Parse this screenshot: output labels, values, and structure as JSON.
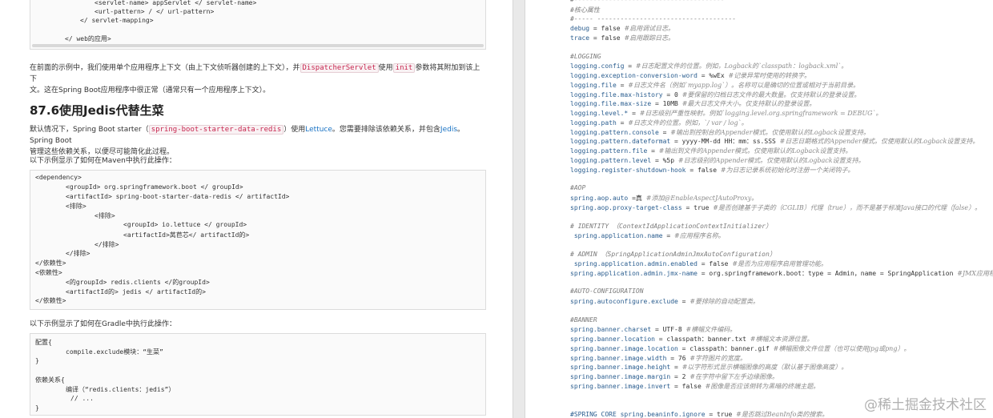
{
  "left": {
    "top_code": [
      {
        "indent": 80,
        "text": "<servlet-name> appServlet </ servlet-name>"
      },
      {
        "indent": 80,
        "text": "<url-pattern> / </ url-pattern>"
      },
      {
        "indent": 62,
        "text": "</ servlet-mapping>"
      },
      {
        "indent": 43,
        "text": ""
      },
      {
        "indent": 43,
        "text": "</ web的应用>"
      }
    ],
    "para1_a": "在前面的示例中，我们使用单个应用程序上下文（由上下文侦听器创建的上下文），并",
    "para1_code1": "DispatcherServlet",
    "para1_b": "使用",
    "para1_code2": "init",
    "para1_c": "参数将其附加到该上下",
    "para1_d": "文。这在Spring Boot应用程序中很正常（通常只有一个应用程序上下文）。",
    "heading": "87.6使用Jedis代替生菜",
    "para2_a": "默认情况下，Spring Boot starter（",
    "para2_code": "spring-boot-starter-data-redis",
    "para2_b": "）使用",
    "para2_link1": "Lettuce",
    "para2_c": "。您需要排除该依赖关系，并包含",
    "para2_link2": "Jedis",
    "para2_d": "。Spring Boot",
    "para2_e": "管理这些依赖关系，以便尽可能简化此过程。",
    "maven_caption": "以下示例显示了如何在Maven中执行此操作：",
    "maven_code": [
      {
        "indent": 0,
        "text": "<dependency>"
      },
      {
        "indent": 38,
        "text": "<groupId> org.springframework.boot </ groupId>"
      },
      {
        "indent": 38,
        "text": "<artifactId> spring-boot-starter-data-redis </ artifactId>"
      },
      {
        "indent": 38,
        "text": "<排除>"
      },
      {
        "indent": 74,
        "text": "<排除>"
      },
      {
        "indent": 110,
        "text": "<groupId> io.lettuce </ groupId>"
      },
      {
        "indent": 110,
        "text": "<artifactId>莴苣芯</ artifactId的>"
      },
      {
        "indent": 74,
        "text": "</排除>"
      },
      {
        "indent": 38,
        "text": "</排除>"
      },
      {
        "indent": 0,
        "text": "</依赖性>"
      },
      {
        "indent": 0,
        "text": "<依赖性>"
      },
      {
        "indent": 38,
        "text": "<的groupId> redis.clients </的groupId>"
      },
      {
        "indent": 38,
        "text": "<artifactId的> jedis </ artifactId的>"
      },
      {
        "indent": 0,
        "text": "</依赖性>"
      }
    ],
    "gradle_caption": "以下示例显示了如何在Gradle中执行此操作：",
    "gradle_code": [
      {
        "indent": 0,
        "text": "配置{"
      },
      {
        "indent": 38,
        "text": "compile.exclude模块：“生菜”"
      },
      {
        "indent": 0,
        "text": "}"
      },
      {
        "indent": 0,
        "text": ""
      },
      {
        "indent": 0,
        "text": "依赖关系{"
      },
      {
        "indent": 38,
        "text": "编译（“redis.clients：jedis”）"
      },
      {
        "indent": 44,
        "text": "// ..."
      },
      {
        "indent": 0,
        "text": "}"
      }
    ]
  },
  "right": {
    "lines": [
      {
        "k": "",
        "v": "",
        "c": "#---------------------------------------"
      },
      {
        "k": "",
        "v": "",
        "c": "#核心属性"
      },
      {
        "k": "",
        "v": "",
        "c": "#----- ------------------------------------"
      },
      {
        "k": "debug",
        "v": " = false ",
        "c": "#启用调试日志。"
      },
      {
        "k": "trace",
        "v": " = false ",
        "c": "#启用跟踪日志。"
      },
      {
        "k": "",
        "v": "",
        "c": ""
      },
      {
        "k": "",
        "v": "",
        "c": "#LOGGING"
      },
      {
        "k": "logging.config",
        "v": " = ",
        "c": "#日志配置文件的位置。例如，Logback的`classpath：logback.xml`。"
      },
      {
        "k": "logging.exception-conversion-word",
        "v": " = %wEx ",
        "c": "#记录异常时使用的转换字。"
      },
      {
        "k": "logging.file",
        "v": " = ",
        "c": "#日志文件名（例如`myapp.log`）。名称可以是确切的位置或相对于当前目录。"
      },
      {
        "k": "logging.file.max-history",
        "v": " = 0 ",
        "c": "#要保留的归档日志文件的最大数量。仅支持默认的登录设置。"
      },
      {
        "k": "logging.file.max-size",
        "v": " = 10MB ",
        "c": "#最大日志文件大小。仅支持默认的登录设置。"
      },
      {
        "k": "logging.level.*",
        "v": " = ",
        "c": "#日志级别严重性映射。例如`logging.level.org.springframework = DEBUG`。"
      },
      {
        "k": "logging.path",
        "v": " = ",
        "c": "#日志文件的位置。例如，`/ var / log`。"
      },
      {
        "k": "logging.pattern.console",
        "v": " = ",
        "c": "#输出到控制台的Appender模式。仅使用默认的Logback设置支持。"
      },
      {
        "k": "logging.pattern.dateformat",
        "v": " = yyyy-MM-dd HH：mm：ss.SSS ",
        "c": "#日志日期格式的Appender模式。仅使用默认的Logback设置支持。"
      },
      {
        "k": "logging.pattern.file",
        "v": " = ",
        "c": "#输出到文件的Appender模式。仅使用默认的Logback设置支持。"
      },
      {
        "k": "logging.pattern.level",
        "v": " = %5p ",
        "c": "#日志级别的Appender模式。仅使用默认的Logback设置支持。"
      },
      {
        "k": "logging.register-shutdown-hook",
        "v": " = false ",
        "c": "#为日志记录系统初始化时注册一个关闭钩子。"
      },
      {
        "k": "",
        "v": "",
        "c": ""
      },
      {
        "k": "",
        "v": "",
        "c": "#AOP"
      },
      {
        "k": "spring.aop.auto",
        "v": " =真 ",
        "c": "#添加@EnableAspectJAutoProxy。"
      },
      {
        "k": "spring.aop.proxy-target-class",
        "v": " = true ",
        "c": "#是否创建基于子类的（CGLIB）代理（true），而不是基于标准Java接口的代理（false）。"
      },
      {
        "k": "",
        "v": "",
        "c": ""
      },
      {
        "k": "",
        "v": "",
        "c": "# IDENTITY （ContextIdApplicationContextInitializer）"
      },
      {
        "k": " spring.application.name",
        "v": " = ",
        "c": "#应用程序名称。"
      },
      {
        "k": "",
        "v": "",
        "c": ""
      },
      {
        "k": "",
        "v": "",
        "c": "# ADMIN （SpringApplicationAdminJmxAutoConfiguration）"
      },
      {
        "k": " spring.application.admin.enabled",
        "v": " = false ",
        "c": "#是否为应用程序启用管理功能。"
      },
      {
        "k": "spring.application.admin.jmx-name",
        "v": " = org.springframework.boot：type = Admin，name = SpringApplication ",
        "c": "#JMX应用程序"
      },
      {
        "k": "",
        "v": "",
        "c": ""
      },
      {
        "k": "",
        "v": "",
        "c": "#AUTO-CONFIGURATION"
      },
      {
        "k": "spring.autoconfigure.exclude",
        "v": " = ",
        "c": "#要排除的自动配置类。"
      },
      {
        "k": "",
        "v": "",
        "c": ""
      },
      {
        "k": "",
        "v": "",
        "c": "#BANNER"
      },
      {
        "k": "spring.banner.charset",
        "v": " = UTF-8 ",
        "c": "#横幅文件编码。"
      },
      {
        "k": "spring.banner.location",
        "v": " = classpath：banner.txt ",
        "c": "#横幅文本资源位置。"
      },
      {
        "k": "spring.banner.image.location",
        "v": " = classpath：banner.gif ",
        "c": "#横幅图像文件位置（也可以使用jpg或png）。"
      },
      {
        "k": "spring.banner.image.width",
        "v": " = 76 ",
        "c": "#字符图片的宽度。"
      },
      {
        "k": "spring.banner.image.height",
        "v": " = ",
        "c": "#以字符形式显示横幅图像的高度（默认基于图像高度）。"
      },
      {
        "k": "spring.banner.image.margin",
        "v": " = 2 ",
        "c": "#在字符中留下左手边缘图像。"
      },
      {
        "k": "spring.banner.image.invert",
        "v": " = false ",
        "c": "#图像是否应该倒转为黑暗的终端主题。"
      },
      {
        "k": "",
        "v": "",
        "c": ""
      },
      {
        "k": "",
        "v": "",
        "c": ""
      },
      {
        "k": "#SPRING CORE spring.beaninfo.ignore",
        "v": " = true ",
        "c": "#是否跳过BeanInfo类的搜索。"
      }
    ]
  },
  "watermark": "@稀土掘金技术社区"
}
